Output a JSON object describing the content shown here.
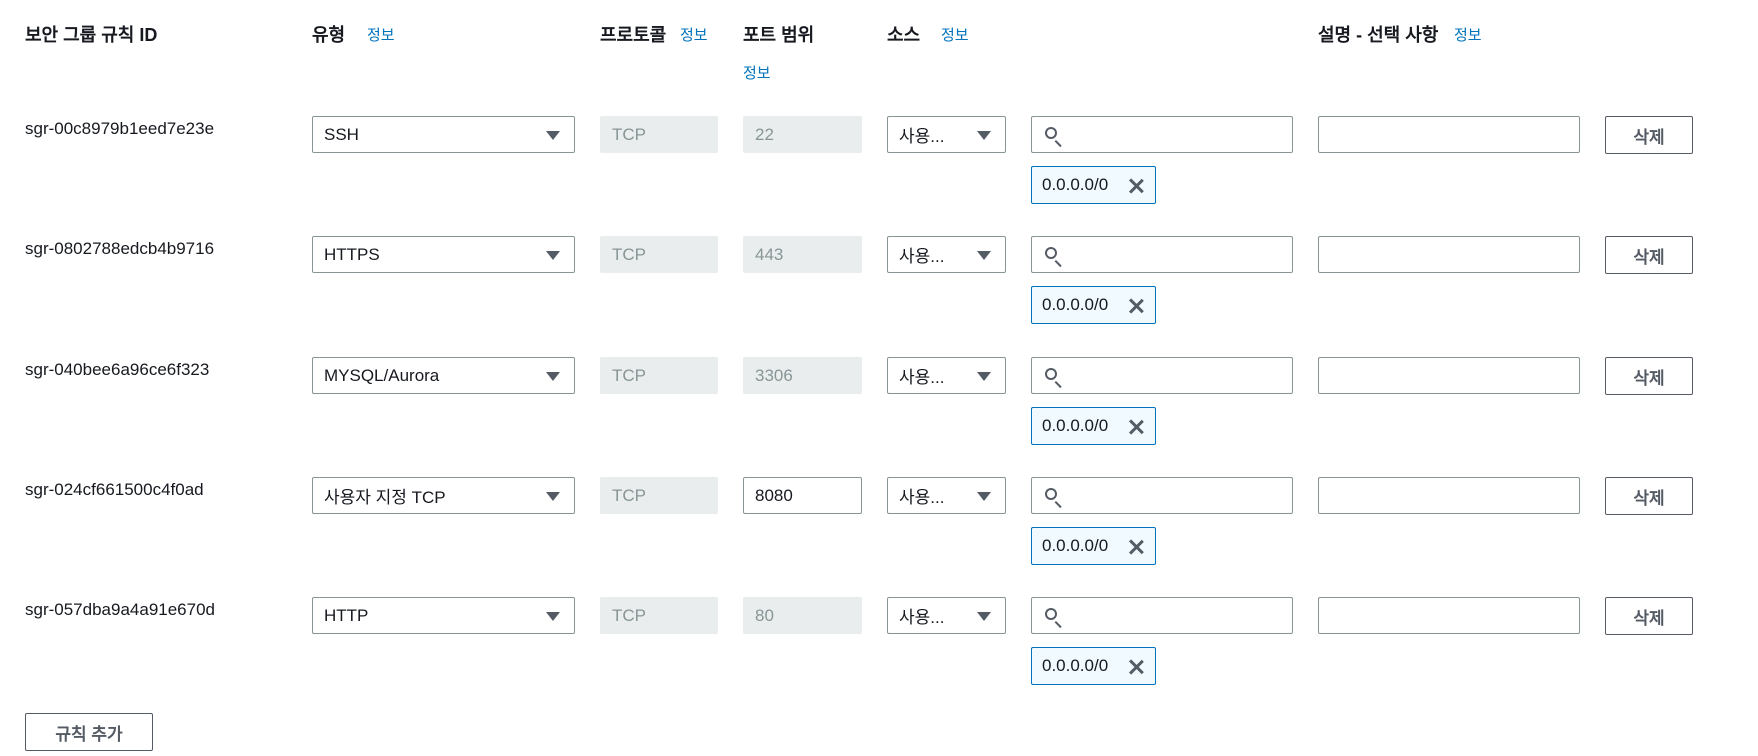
{
  "headers": {
    "rule_id": "보안 그룹 규칙 ID",
    "type": "유형",
    "type_info": "정보",
    "protocol": "프로토콜",
    "protocol_info": "정보",
    "port_range": "포트 범위",
    "port_range_info": "정보",
    "source": "소스",
    "source_info": "정보",
    "description": "설명 - 선택 사항",
    "description_info": "정보"
  },
  "rules": [
    {
      "id": "sgr-00c8979b1eed7e23e",
      "type": "SSH",
      "protocol": "TCP",
      "port": "22",
      "port_editable": false,
      "source_type": "사용...",
      "source_search": "",
      "cidr": "0.0.0.0/0",
      "description": "",
      "delete_label": "삭제"
    },
    {
      "id": "sgr-0802788edcb4b9716",
      "type": "HTTPS",
      "protocol": "TCP",
      "port": "443",
      "port_editable": false,
      "source_type": "사용...",
      "source_search": "",
      "cidr": "0.0.0.0/0",
      "description": "",
      "delete_label": "삭제"
    },
    {
      "id": "sgr-040bee6a96ce6f323",
      "type": "MYSQL/Aurora",
      "protocol": "TCP",
      "port": "3306",
      "port_editable": false,
      "source_type": "사용...",
      "source_search": "",
      "cidr": "0.0.0.0/0",
      "description": "",
      "delete_label": "삭제"
    },
    {
      "id": "sgr-024cf661500c4f0ad",
      "type": "사용자 지정 TCP",
      "protocol": "TCP",
      "port": "8080",
      "port_editable": true,
      "source_type": "사용...",
      "source_search": "",
      "cidr": "0.0.0.0/0",
      "description": "",
      "delete_label": "삭제"
    },
    {
      "id": "sgr-057dba9a4a91e670d",
      "type": "HTTP",
      "protocol": "TCP",
      "port": "80",
      "port_editable": false,
      "source_type": "사용...",
      "source_search": "",
      "cidr": "0.0.0.0/0",
      "description": "",
      "delete_label": "삭제"
    }
  ],
  "add_rule_label": "규칙 추가"
}
